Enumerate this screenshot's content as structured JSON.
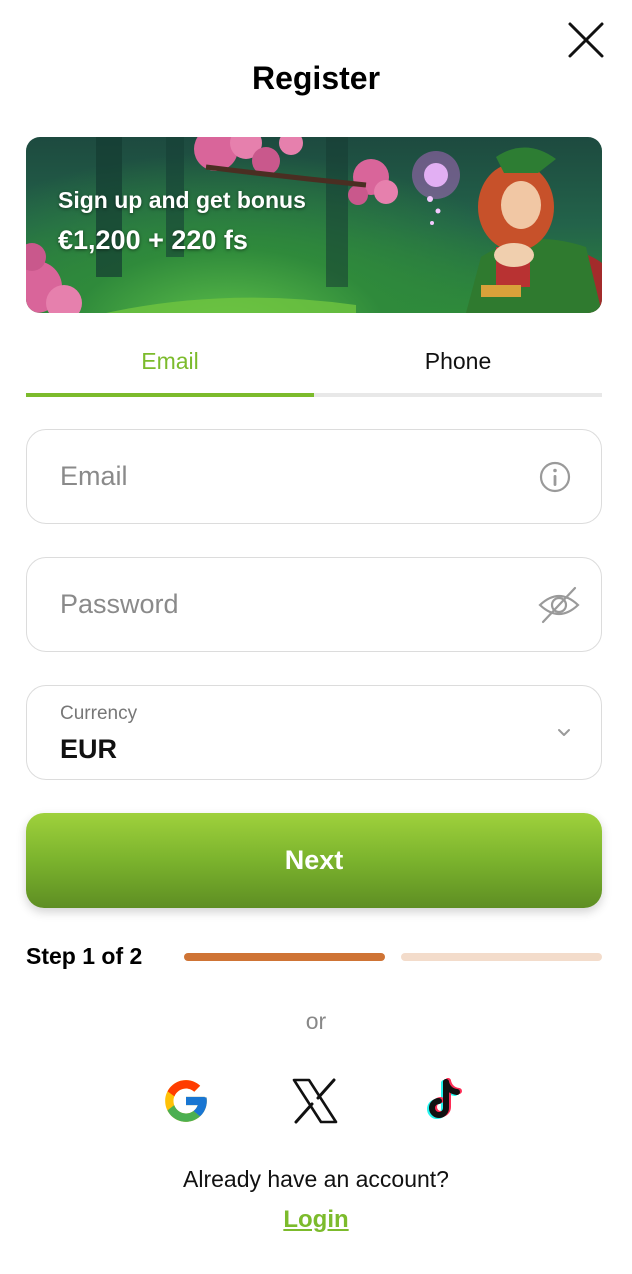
{
  "modal": {
    "title": "Register",
    "close_icon": "close-icon"
  },
  "banner": {
    "line1": "Sign up and get bonus",
    "line2": "€1,200 + 220 fs"
  },
  "tabs": [
    {
      "label": "Email",
      "active": true
    },
    {
      "label": "Phone",
      "active": false
    }
  ],
  "form": {
    "email": {
      "placeholder": "Email",
      "value": "",
      "icon": "info-icon"
    },
    "password": {
      "placeholder": "Password",
      "value": "",
      "icon": "eye-off-icon"
    },
    "currency": {
      "label": "Currency",
      "value": "EUR",
      "icon": "chevron-down-icon"
    },
    "submit_label": "Next"
  },
  "steps": {
    "label": "Step 1 of 2",
    "current": 1,
    "total": 2
  },
  "social": {
    "or_text": "or",
    "providers": [
      "google-icon",
      "x-icon",
      "tiktok-icon"
    ]
  },
  "footer": {
    "account_text": "Already have an account?",
    "login_label": "Login"
  },
  "colors": {
    "accent_green": "#7cbb2c",
    "step_active": "#cf7435",
    "step_inactive": "#f3dccb"
  }
}
